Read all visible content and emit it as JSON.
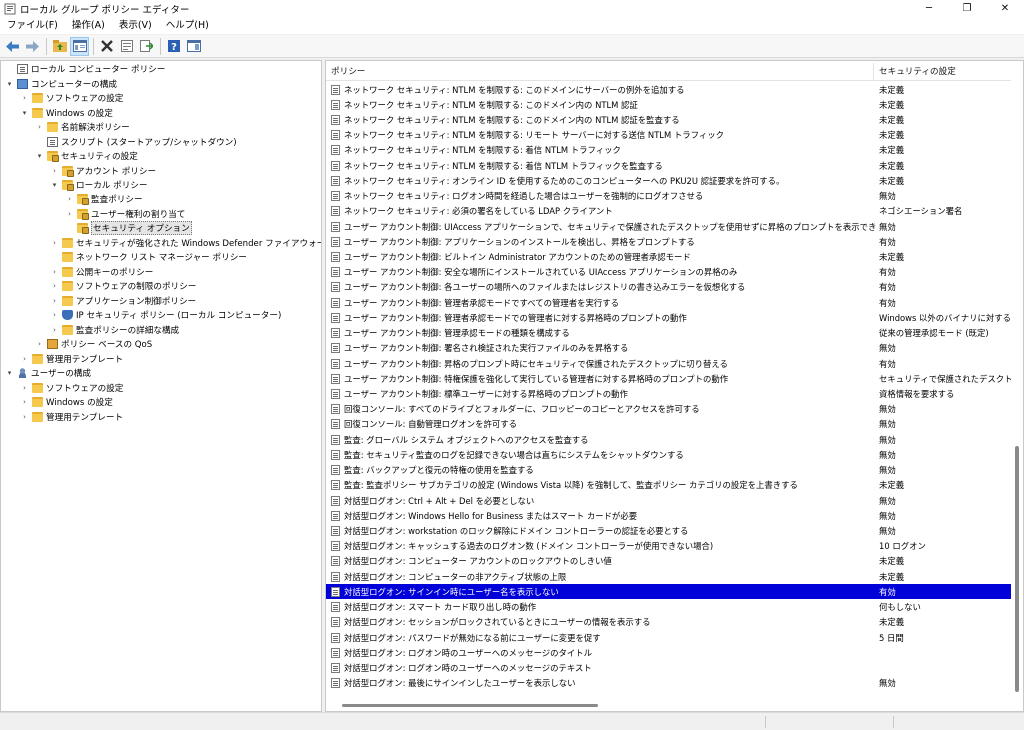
{
  "window": {
    "title": "ローカル グループ ポリシー エディター",
    "minimize": "─",
    "maximize": "❐",
    "close": "✕"
  },
  "menu": [
    "ファイル(F)",
    "操作(A)",
    "表示(V)",
    "ヘルプ(H)"
  ],
  "tree": [
    {
      "label": "ローカル コンピューター ポリシー",
      "level": 0,
      "toggle": "",
      "icon": "doc"
    },
    {
      "label": "コンピューターの構成",
      "level": 0,
      "toggle": "▾",
      "icon": "pc"
    },
    {
      "label": "ソフトウェアの設定",
      "level": 1,
      "toggle": "›",
      "icon": "folder"
    },
    {
      "label": "Windows の設定",
      "level": 1,
      "toggle": "▾",
      "icon": "folder"
    },
    {
      "label": "名前解決ポリシー",
      "level": 2,
      "toggle": "›",
      "icon": "folder"
    },
    {
      "label": "スクリプト (スタートアップ/シャットダウン)",
      "level": 2,
      "toggle": "",
      "icon": "doc"
    },
    {
      "label": "セキュリティの設定",
      "level": 2,
      "toggle": "▾",
      "icon": "folder-lock"
    },
    {
      "label": "アカウント ポリシー",
      "level": 3,
      "toggle": "›",
      "icon": "folder-lock"
    },
    {
      "label": "ローカル ポリシー",
      "level": 3,
      "toggle": "▾",
      "icon": "folder-lock"
    },
    {
      "label": "監査ポリシー",
      "level": 4,
      "toggle": "›",
      "icon": "folder-lock"
    },
    {
      "label": "ユーザー権利の割り当て",
      "level": 4,
      "toggle": "›",
      "icon": "folder-lock"
    },
    {
      "label": "セキュリティ オプション",
      "level": 4,
      "toggle": "",
      "icon": "folder-lock",
      "selected": true
    },
    {
      "label": "セキュリティが強化された Windows Defender ファイアウォール",
      "level": 3,
      "toggle": "›",
      "icon": "folder"
    },
    {
      "label": "ネットワーク リスト マネージャー ポリシー",
      "level": 3,
      "toggle": "",
      "icon": "folder"
    },
    {
      "label": "公開キーのポリシー",
      "level": 3,
      "toggle": "›",
      "icon": "folder"
    },
    {
      "label": "ソフトウェアの制限のポリシー",
      "level": 3,
      "toggle": "›",
      "icon": "folder"
    },
    {
      "label": "アプリケーション制御ポリシー",
      "level": 3,
      "toggle": "›",
      "icon": "folder"
    },
    {
      "label": "IP セキュリティ ポリシー (ローカル コンピューター)",
      "level": 3,
      "toggle": "›",
      "icon": "shield"
    },
    {
      "label": "監査ポリシーの詳細な構成",
      "level": 3,
      "toggle": "›",
      "icon": "folder"
    },
    {
      "label": "ポリシー ベースの QoS",
      "level": 2,
      "toggle": "›",
      "icon": "chart"
    },
    {
      "label": "管理用テンプレート",
      "level": 1,
      "toggle": "›",
      "icon": "folder"
    },
    {
      "label": "ユーザーの構成",
      "level": 0,
      "toggle": "▾",
      "icon": "user"
    },
    {
      "label": "ソフトウェアの設定",
      "level": 1,
      "toggle": "›",
      "icon": "folder"
    },
    {
      "label": "Windows の設定",
      "level": 1,
      "toggle": "›",
      "icon": "folder"
    },
    {
      "label": "管理用テンプレート",
      "level": 1,
      "toggle": "›",
      "icon": "folder"
    }
  ],
  "list": {
    "columns": {
      "policy": "ポリシー",
      "setting": "セキュリティの設定"
    },
    "sort_caret": "^",
    "rows": [
      {
        "policy": "ネットワーク セキュリティ: NTLM を制限する: このドメインにサーバーの例外を追加する",
        "setting": "未定義"
      },
      {
        "policy": "ネットワーク セキュリティ: NTLM を制限する: このドメイン内の NTLM 認証",
        "setting": "未定義"
      },
      {
        "policy": "ネットワーク セキュリティ: NTLM を制限する: このドメイン内の NTLM 認証を監査する",
        "setting": "未定義"
      },
      {
        "policy": "ネットワーク セキュリティ: NTLM を制限する: リモート サーバーに対する送信 NTLM トラフィック",
        "setting": "未定義"
      },
      {
        "policy": "ネットワーク セキュリティ: NTLM を制限する: 着信 NTLM トラフィック",
        "setting": "未定義"
      },
      {
        "policy": "ネットワーク セキュリティ: NTLM を制限する: 着信 NTLM トラフィックを監査する",
        "setting": "未定義"
      },
      {
        "policy": "ネットワーク セキュリティ: オンライン ID を使用するためのこのコンピューターへの PKU2U 認証要求を許可する。",
        "setting": "未定義"
      },
      {
        "policy": "ネットワーク セキュリティ: ログオン時間を経過した場合はユーザーを強制的にログオフさせる",
        "setting": "無効"
      },
      {
        "policy": "ネットワーク セキュリティ: 必須の署名をしている LDAP クライアント",
        "setting": "ネゴシエーション署名"
      },
      {
        "policy": "ユーザー アカウント制御: UIAccess アプリケーションで、セキュリティで保護されたデスクトップを使用せずに昇格のプロンプトを表示できるようにする",
        "setting": "無効"
      },
      {
        "policy": "ユーザー アカウント制御: アプリケーションのインストールを検出し、昇格をプロンプトする",
        "setting": "有効"
      },
      {
        "policy": "ユーザー アカウント制御: ビルトイン Administrator アカウントのための管理者承認モード",
        "setting": "未定義"
      },
      {
        "policy": "ユーザー アカウント制御: 安全な場所にインストールされている UIAccess アプリケーションの昇格のみ",
        "setting": "有効"
      },
      {
        "policy": "ユーザー アカウント制御: 各ユーザーの場所へのファイルまたはレジストリの書き込みエラーを仮想化する",
        "setting": "有効"
      },
      {
        "policy": "ユーザー アカウント制御: 管理者承認モードですべての管理者を実行する",
        "setting": "有効"
      },
      {
        "policy": "ユーザー アカウント制御: 管理者承認モードでの管理者に対する昇格時のプロンプトの動作",
        "setting": "Windows 以外のバイナリに対する同"
      },
      {
        "policy": "ユーザー アカウント制御: 管理承認モードの種類を構成する",
        "setting": "従来の管理承認モード (既定)"
      },
      {
        "policy": "ユーザー アカウント制御: 署名され検証された実行ファイルのみを昇格する",
        "setting": "無効"
      },
      {
        "policy": "ユーザー アカウント制御: 昇格のプロンプト時にセキュリティで保護されたデスクトップに切り替える",
        "setting": "有効"
      },
      {
        "policy": "ユーザー アカウント制御: 特権保護を強化して実行している管理者に対する昇格時のプロンプトの動作",
        "setting": "セキュリティで保護されたデスクトップ"
      },
      {
        "policy": "ユーザー アカウント制御: 標準ユーザーに対する昇格時のプロンプトの動作",
        "setting": "資格情報を要求する"
      },
      {
        "policy": "回復コンソール: すべてのドライブとフォルダーに、フロッピーのコピーとアクセスを許可する",
        "setting": "無効"
      },
      {
        "policy": "回復コンソール: 自動管理ログオンを許可する",
        "setting": "無効"
      },
      {
        "policy": "監査: グローバル システム オブジェクトへのアクセスを監査する",
        "setting": "無効"
      },
      {
        "policy": "監査: セキュリティ監査のログを記録できない場合は直ちにシステムをシャットダウンする",
        "setting": "無効"
      },
      {
        "policy": "監査: バックアップと復元の特権の使用を監査する",
        "setting": "無効"
      },
      {
        "policy": "監査: 監査ポリシー サブカテゴリの設定 (Windows Vista 以降) を強制して、監査ポリシー カテゴリの設定を上書きする",
        "setting": "未定義"
      },
      {
        "policy": "対話型ログオン: Ctrl + Alt + Del を必要としない",
        "setting": "無効"
      },
      {
        "policy": "対話型ログオン: Windows Hello for Business またはスマート カードが必要",
        "setting": "無効"
      },
      {
        "policy": "対話型ログオン: workstation のロック解除にドメイン コントローラーの認証を必要とする",
        "setting": "無効"
      },
      {
        "policy": "対話型ログオン: キャッシュする過去のログオン数 (ドメイン コントローラーが使用できない場合)",
        "setting": "10 ログオン"
      },
      {
        "policy": "対話型ログオン: コンピューター アカウントのロックアウトのしきい値",
        "setting": "未定義"
      },
      {
        "policy": "対話型ログオン: コンピューターの非アクティブ状態の上限",
        "setting": "未定義"
      },
      {
        "policy": "対話型ログオン: サインイン時にユーザー名を表示しない",
        "setting": "有効",
        "selected": true
      },
      {
        "policy": "対話型ログオン: スマート カード取り出し時の動作",
        "setting": "何もしない"
      },
      {
        "policy": "対話型ログオン: セッションがロックされているときにユーザーの情報を表示する",
        "setting": "未定義"
      },
      {
        "policy": "対話型ログオン: パスワードが無効になる前にユーザーに変更を促す",
        "setting": "5 日間"
      },
      {
        "policy": "対話型ログオン: ログオン時のユーザーへのメッセージのタイトル",
        "setting": ""
      },
      {
        "policy": "対話型ログオン: ログオン時のユーザーへのメッセージのテキスト",
        "setting": ""
      },
      {
        "policy": "対話型ログオン: 最後にサインインしたユーザーを表示しない",
        "setting": "無効"
      }
    ]
  }
}
